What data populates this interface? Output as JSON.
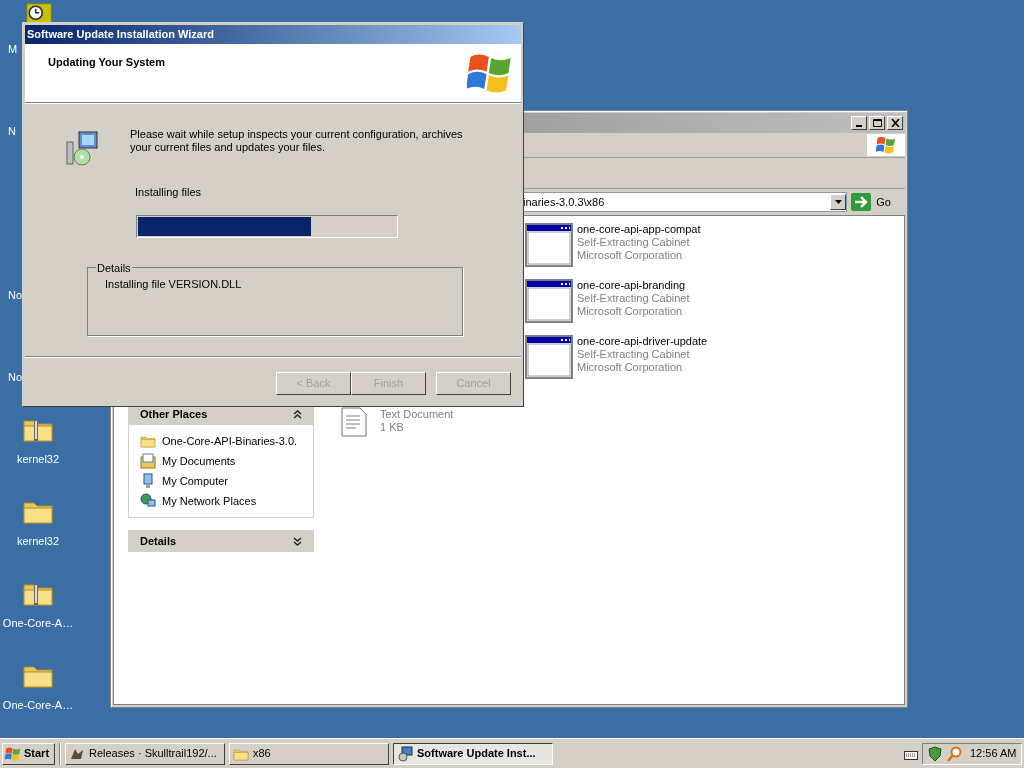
{
  "desktop": {
    "icons": [
      {
        "kind": "clock",
        "label": "M"
      },
      {
        "kind": "hidden",
        "label": "N"
      },
      {
        "kind": "hidden",
        "label": "No"
      },
      {
        "kind": "hidden",
        "label": "No"
      },
      {
        "kind": "zip",
        "label": "kernel32"
      },
      {
        "kind": "folder",
        "label": "kernel32"
      },
      {
        "kind": "zip",
        "label": "One-Core-A…"
      },
      {
        "kind": "folder",
        "label": "One-Core-A…"
      }
    ]
  },
  "explorer": {
    "address": "inaries-3.0.3\\x86",
    "go_label": "Go",
    "panels": [
      {
        "title": "Other Places",
        "expanded": true,
        "items": [
          {
            "kind": "folder",
            "label": "One-Core-API-Binaries-3.0."
          },
          {
            "kind": "documents",
            "label": "My Documents"
          },
          {
            "kind": "computer",
            "label": "My Computer"
          },
          {
            "kind": "network",
            "label": "My Network Places"
          }
        ]
      },
      {
        "title": "Details",
        "expanded": false
      }
    ],
    "files": [
      {
        "kind": "cabinet",
        "name": "one-core-api-app-compat",
        "type": "Self-Extracting Cabinet",
        "company": "Microsoft Corporation"
      },
      {
        "kind": "cabinet",
        "name": "one-core-api-branding",
        "type": "Self-Extracting Cabinet",
        "company": "Microsoft Corporation"
      },
      {
        "kind": "cabinet",
        "name": "one-core-api-driver-update",
        "type": "Self-Extracting Cabinet",
        "company": "Microsoft Corporation"
      },
      {
        "kind": "text",
        "type": "Text Document",
        "size": "1 KB"
      }
    ]
  },
  "wizard": {
    "title": "Software Update Installation Wizard",
    "heading": "Updating Your System",
    "message": "Please wait while setup inspects your current configuration, archives your current files and updates your files.",
    "progress": {
      "label": "Installing files",
      "level": 0.67
    },
    "details": {
      "title": "Details",
      "text": "Installing file VERSION.DLL"
    },
    "buttons": [
      {
        "label": "< Back",
        "disabled": true
      },
      {
        "label": "Finish",
        "disabled": true
      },
      {
        "label": "Cancel",
        "disabled": true
      }
    ]
  },
  "taskbar": {
    "start": "Start",
    "tasks": [
      {
        "kind": "browser",
        "label": "Releases · Skulltrail192/...",
        "selected": false
      },
      {
        "kind": "folder",
        "label": "x86",
        "selected": false
      },
      {
        "kind": "setup",
        "label": "Software Update Inst...",
        "selected": true
      }
    ],
    "clock": "12:56 AM"
  }
}
